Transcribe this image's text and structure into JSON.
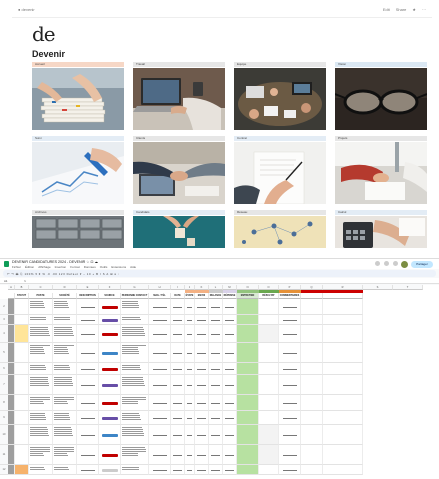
{
  "notion": {
    "breadcrumb": "● devenir",
    "topbar_right": [
      "Edit",
      "Share",
      "★",
      "···"
    ],
    "logo": "de",
    "title": "Devenir",
    "cards": [
      {
        "label": "Accueil",
        "color": "#f6d7c6",
        "photo": "papers"
      },
      {
        "label": "Travail",
        "color": "#e6e6e6",
        "photo": "laptop"
      },
      {
        "label": "Equipe",
        "color": "#e6e6e6",
        "photo": "meeting"
      },
      {
        "label": "Vision",
        "color": "#dbe8f3",
        "photo": "glasses"
      },
      {
        "label": "Suivi",
        "color": "#e3ecf5",
        "photo": "chart"
      },
      {
        "label": "Clients",
        "color": "#e6e6e6",
        "photo": "handshake"
      },
      {
        "label": "Contrat",
        "color": "#e3ecf5",
        "photo": "signing"
      },
      {
        "label": "Projets",
        "color": "#e6e6e6",
        "photo": "writing"
      },
      {
        "label": "Archives",
        "color": "#e6e6e6",
        "photo": "cabinets"
      },
      {
        "label": "Candidats",
        "color": "#e3ecf5",
        "photo": "blocks"
      },
      {
        "label": "Réseau",
        "color": "#e6e6e6",
        "photo": "network"
      },
      {
        "label": "Calcul",
        "color": "#e3ecf5",
        "photo": "calculator"
      }
    ]
  },
  "sheets": {
    "doc_title": "DEVENIR CANDIDATURES 2024 - DEVENIR ☆ ⊡ ☁",
    "menu": [
      "Fichier",
      "Édition",
      "Affichage",
      "Insertion",
      "Format",
      "Données",
      "Outils",
      "Extensions",
      "Aide"
    ],
    "share_label": "Partager",
    "toolbar_text": "↶ ↷ 🖶 ⎘ 100% ▾ € % .0 .00 123  Défaut ▾ − 10 + B I S A ⊞ ≡ ⫶",
    "cell_ref": "A1",
    "fx": "fx",
    "col_letters": [
      "A",
      "B",
      "C",
      "D",
      "E",
      "F",
      "G",
      "H",
      "I",
      "J",
      "K",
      "L",
      "M",
      "N",
      "O",
      "P",
      "Q",
      "R",
      "S",
      "T"
    ],
    "headers": [
      "",
      "STATUT",
      "POSTE",
      "SOCIÉTÉ",
      "DESCRIPTION",
      "SOURCE",
      "PERSONNE CONTACT",
      "MAIL / TÉL",
      "DATE",
      "ÉTAPE",
      "ENVOI",
      "RELANCE",
      "RÉPONSE",
      "ENTRETIEN",
      "RÉSULTAT",
      "COMMENTAIRES",
      "",
      ""
    ],
    "row_numbers": [
      "2",
      "3",
      "4",
      "5",
      "6",
      "7",
      "8",
      "9",
      "10",
      "11",
      "12"
    ],
    "status_colors": {
      "green": "#b7e1a1",
      "orange": "#f9cb9c",
      "yellow": "#ffe599",
      "red": "#c00000",
      "purple": "#674ea7",
      "blue": "#3d85c6"
    }
  }
}
